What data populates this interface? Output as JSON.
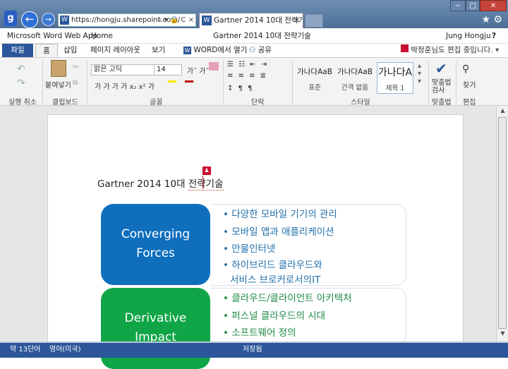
{
  "browser": {
    "address": "https://hongju.sharepoint.com/",
    "tab_title": "Gartner 2014 10대 전략기...",
    "tab_close": "×",
    "back_glyph": "←",
    "forward_glyph": "→",
    "app_glyph": "g",
    "addr_icons": "⌕ ▾ 🔒 C ×",
    "win_min": "−",
    "win_max": "□",
    "win_close": "✕",
    "star_gear": "★ ⚙"
  },
  "appbar": {
    "app_name": "Microsoft Word Web App",
    "home": "Home",
    "doc_title": "Gartner 2014 10대 전략기술",
    "user": "Jung Hongju",
    "help": "?"
  },
  "tabs": {
    "file": "파일",
    "home": "홈",
    "insert": "삽입",
    "layout": "페이지 레이아웃",
    "view": "보기",
    "open_in_word": "WORD에서 열기",
    "share": "공유",
    "editing_status": "박정훈님도 편집 중입니다."
  },
  "ribbon": {
    "undo_group": "실행 취소",
    "paste": "붙여넣기",
    "clipboard_group": "클립보드",
    "font_name": "맑은 고딕",
    "font_size": "14",
    "font_group": "글꼴",
    "paragraph_group": "단락",
    "styles": [
      {
        "sample": "가나다AaB",
        "label": "표준"
      },
      {
        "sample": "가나다AaB",
        "label": "간격 없음"
      },
      {
        "sample": "가나다A",
        "label": "제목 1"
      }
    ],
    "styles_group": "스타일",
    "spellcheck": "맞춤법\n검사",
    "spell_group": "맞춤법",
    "find": "찾기",
    "edit_group": "편집",
    "format_row1": "가 가 가 가 x₂ x² 가",
    "format_row2": "가ˆ  가ˇ"
  },
  "document": {
    "title_plain": "Gartner 2014 10대 ",
    "title_underlined": "전략기술",
    "presence_icon": "person-icon",
    "blocks": [
      {
        "heading": [
          "Converging",
          "Forces"
        ],
        "items": [
          "다양한 모바일 기기의 관리",
          "모바일 앱과 애플리케이션",
          "만물인터넷",
          "하이브리드 클라우드와",
          "서비스 브로커로서의IT"
        ]
      },
      {
        "heading": [
          "Derivative",
          "Impact"
        ],
        "items": [
          "클라우드/클라이언트 아키텍처",
          "퍼스널 클라우드의 시대",
          "소프트웨어 정의"
        ]
      }
    ]
  },
  "status": {
    "words": "약 13단어",
    "language": "영어(미국)",
    "saved": "저장됨"
  },
  "colors": {
    "word_blue": "#2b579a",
    "box_blue": "#0f6fbd",
    "box_green": "#10a547"
  }
}
